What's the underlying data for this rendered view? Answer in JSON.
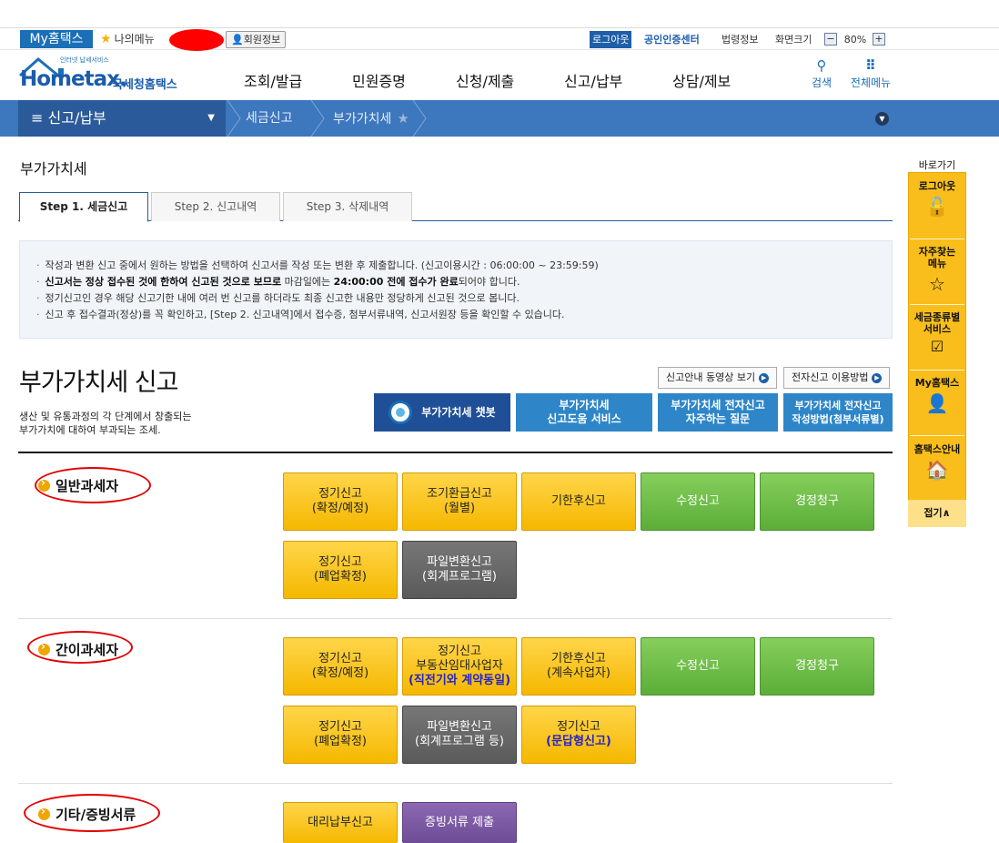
{
  "util": {
    "myhometax": "My홈택스",
    "mymenu": "나의메뉴",
    "member": "회원정보",
    "logout": "로그아웃",
    "cert": "공인인증센터",
    "law": "법령정보",
    "screen_size": "화면크기",
    "zoom": "80%",
    "zoom_minus": "−",
    "zoom_plus": "+"
  },
  "header": {
    "logo_small": "인터넷 납세서비스",
    "logo_main": "Hometax.",
    "logo_sub": "국세청홈택스",
    "nav": [
      "조회/발급",
      "민원증명",
      "신청/제출",
      "신고/납부",
      "상담/제보"
    ],
    "search": "검색",
    "allmenu": "전체메뉴"
  },
  "breadcrumb": {
    "first": "신고/납부",
    "second": "세금신고",
    "third": "부가가치세"
  },
  "page": {
    "title": "부가가치세",
    "tabs": [
      "Step 1. 세금신고",
      "Step 2. 신고내역",
      "Step 3. 삭제내역"
    ]
  },
  "notice": {
    "line1": "작성과 변환 신고 중에서 원하는 방법을 선택하여 신고서를 작성 또는 변환 후 제출합니다. (신고이용시간 : 06:00:00 ~ 23:59:59)",
    "line2_bold": "신고서는 정상 접수된 것에 한하여 신고된 것으로 보므로",
    "line2_mid": " 마감일에는 ",
    "line2_bold2": "24:00:00 전에 접수가 완료",
    "line2_end": "되어야 합니다.",
    "line3": "정기신고인 경우 해당 신고기한 내에 여러 번 신고를 하더라도 최종 신고한 내용만 정당하게 신고된 것으로 봅니다.",
    "line4": "신고 후 접수결과(정상)를 꼭 확인하고, [Step 2. 신고내역]에서 접수증, 첨부서류내역, 신고서원장 등을 확인할 수 있습니다."
  },
  "vat": {
    "title": "부가가치세 신고",
    "desc1": "생산 및 유통과정의 각 단계에서 창출되는",
    "desc2": "부가가치에 대하여 부과되는 조세.",
    "video_btn": "신고안내 동영상 보기",
    "howto_btn": "전자신고 이용방법",
    "chatbot": "부가가치세 챗봇",
    "help1": "부가가치세",
    "help2": "신고도움 서비스",
    "faq1": "부가가치세 전자신고",
    "faq2": "자주하는 질문",
    "method1": "부가가치세 전자신고",
    "method2": "작성방법(첨부서류별)"
  },
  "sections": {
    "general": {
      "label": "일반과세자",
      "b1a": "정기신고",
      "b1b": "(확정/예정)",
      "b2a": "조기환급신고",
      "b2b": "(월별)",
      "b3": "기한후신고",
      "b4": "수정신고",
      "b5": "경정청구",
      "b6a": "정기신고",
      "b6b": "(폐업확정)",
      "b7a": "파일변환신고",
      "b7b": "(회계프로그램)"
    },
    "simple": {
      "label": "간이과세자",
      "b1a": "정기신고",
      "b1b": "(확정/예정)",
      "b2a": "정기신고",
      "b2b": "부동산임대사업자",
      "b2c": "(직전기와 계약동일)",
      "b3a": "기한후신고",
      "b3b": "(계속사업자)",
      "b4": "수정신고",
      "b5": "경정청구",
      "b6a": "정기신고",
      "b6b": "(폐업확정)",
      "b7a": "파일변환신고",
      "b7b": "(회계프로그램 등)",
      "b8a": "정기신고",
      "b8b": "(문답형신고)"
    },
    "other": {
      "label": "기타/증빙서류",
      "b1": "대리납부신고",
      "b2": "증빙서류 제출"
    }
  },
  "quick": {
    "title": "바로가기",
    "logout": "로그아웃",
    "faq1": "자주찾는",
    "faq2": "메뉴",
    "tax1": "세금종류별",
    "tax2": "서비스",
    "my": "My홈택스",
    "guide": "홈택스안내",
    "fold": "접기∧"
  }
}
